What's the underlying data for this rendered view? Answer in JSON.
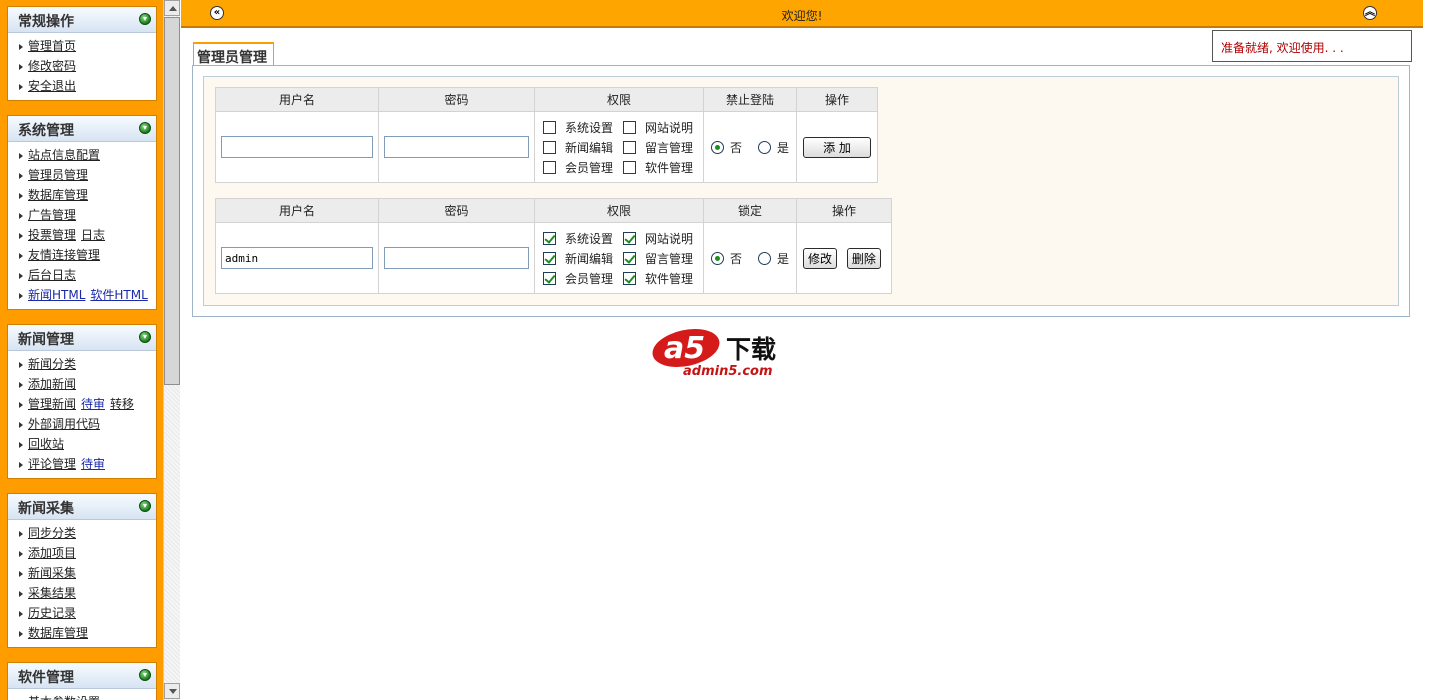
{
  "sidebar": {
    "panels": [
      {
        "title": "常规操作",
        "items": [
          [
            "管理首页"
          ],
          [
            "修改密码"
          ],
          [
            "安全退出"
          ]
        ]
      },
      {
        "title": "系统管理",
        "items": [
          [
            "站点信息配置"
          ],
          [
            "管理员管理"
          ],
          [
            "数据库管理"
          ],
          [
            "广告管理"
          ],
          [
            "投票管理",
            "日志"
          ],
          [
            "友情连接管理"
          ],
          [
            "后台日志"
          ],
          [
            "新闻HTML",
            "软件HTML"
          ]
        ]
      },
      {
        "title": "新闻管理",
        "items": [
          [
            "新闻分类"
          ],
          [
            "添加新闻"
          ],
          [
            "管理新闻",
            "待审",
            "转移"
          ],
          [
            "外部调用代码"
          ],
          [
            "回收站"
          ],
          [
            "评论管理",
            "待审"
          ]
        ]
      },
      {
        "title": "新闻采集",
        "items": [
          [
            "同步分类"
          ],
          [
            "添加项目"
          ],
          [
            "新闻采集"
          ],
          [
            "采集结果"
          ],
          [
            "历史记录"
          ],
          [
            "数据库管理"
          ]
        ]
      },
      {
        "title": "软件管理",
        "items": [
          [
            "基本参数设置"
          ]
        ]
      }
    ]
  },
  "topbar": {
    "title": "欢迎您!"
  },
  "status": {
    "text": "准备就绪, 欢迎使用. . ."
  },
  "tab": {
    "label": "管理员管理"
  },
  "add_table": {
    "headers": [
      "用户名",
      "密码",
      "权限",
      "禁止登陆",
      "操作"
    ],
    "username": "",
    "password": "",
    "perms": [
      {
        "label": "系统设置",
        "checked": false
      },
      {
        "label": "网站说明",
        "checked": false
      },
      {
        "label": "新闻编辑",
        "checked": false
      },
      {
        "label": "留言管理",
        "checked": false
      },
      {
        "label": "会员管理",
        "checked": false
      },
      {
        "label": "软件管理",
        "checked": false
      }
    ],
    "radio_no": "否",
    "radio_yes": "是",
    "add_button": "添 加"
  },
  "user_table": {
    "headers": [
      "用户名",
      "密码",
      "权限",
      "锁定",
      "操作"
    ],
    "username": "admin",
    "password": "",
    "perms": [
      {
        "label": "系统设置",
        "checked": true
      },
      {
        "label": "网站说明",
        "checked": true
      },
      {
        "label": "新闻编辑",
        "checked": true
      },
      {
        "label": "留言管理",
        "checked": true
      },
      {
        "label": "会员管理",
        "checked": true
      },
      {
        "label": "软件管理",
        "checked": true
      }
    ],
    "radio_no": "否",
    "radio_yes": "是",
    "edit_button": "修改",
    "delete_button": "删除"
  },
  "logo": {
    "main": "a5",
    "suffix": "下载",
    "domain": "admin5.com"
  },
  "colors": {
    "accent": "#ffa500",
    "status_text": "#b00000",
    "link_blue": "#1a2aa8"
  }
}
